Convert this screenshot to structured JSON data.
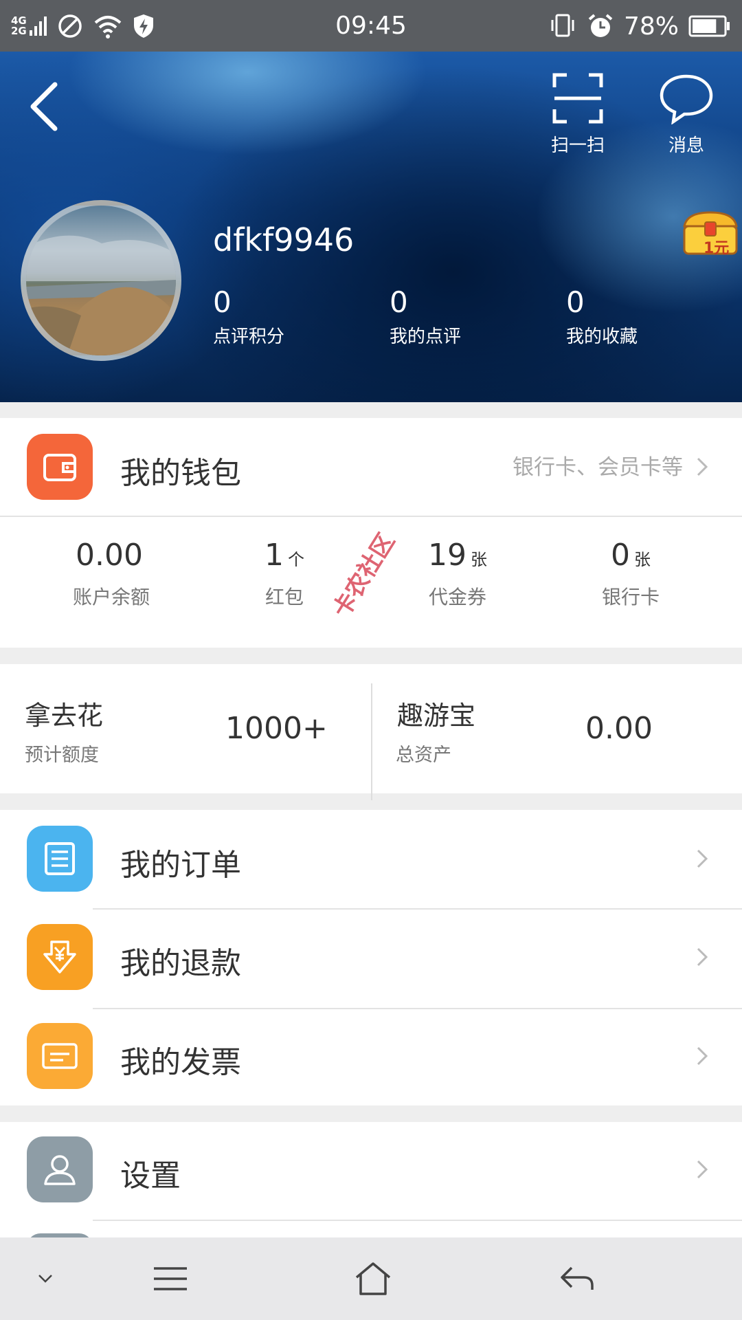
{
  "status_bar": {
    "network_top": "4G",
    "network_bottom": "2G",
    "time": "09:45",
    "battery_percent": "78%",
    "battery_level": 0.78
  },
  "header": {
    "scan_label": "扫一扫",
    "message_label": "消息",
    "username": "dfkf9946",
    "stats": [
      {
        "value": "0",
        "label": "点评积分"
      },
      {
        "value": "0",
        "label": "我的点评"
      },
      {
        "value": "0",
        "label": "我的收藏"
      }
    ],
    "gift_badge": "1元"
  },
  "wallet": {
    "title": "我的钱包",
    "hint": "银行卡、会员卡等",
    "stats": [
      {
        "value": "0.00",
        "unit": "",
        "label": "账户余额"
      },
      {
        "value": "1",
        "unit": "个",
        "label": "红包"
      },
      {
        "value": "19",
        "unit": "张",
        "label": "代金券"
      },
      {
        "value": "0",
        "unit": "张",
        "label": "银行卡"
      }
    ]
  },
  "finance": {
    "left": {
      "title": "拿去花",
      "subtitle": "预计额度",
      "value": "1000+"
    },
    "right": {
      "title": "趣游宝",
      "subtitle": "总资产",
      "value": "0.00"
    }
  },
  "menu": {
    "orders": "我的订单",
    "refunds": "我的退款",
    "invoices": "我的发票",
    "settings": "设置"
  },
  "watermark": "卡农社区",
  "colors": {
    "wallet_icon": "#f4663a",
    "orders_icon": "#4bb4ef",
    "refunds_icon": "#f8a023",
    "invoices_icon": "#fbaa35",
    "settings_icon": "#8e9da6"
  }
}
